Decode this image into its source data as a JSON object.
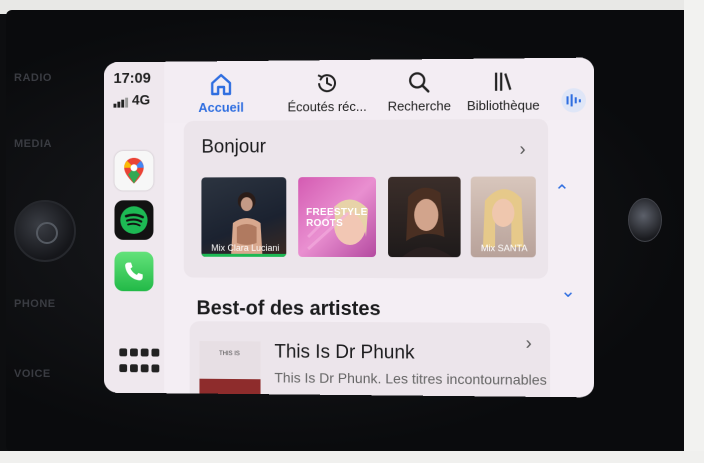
{
  "status": {
    "time": "17:09",
    "network": "4G"
  },
  "dock": {
    "apps": [
      {
        "name": "Google Maps"
      },
      {
        "name": "Spotify"
      },
      {
        "name": "Téléphone"
      }
    ]
  },
  "hardware": {
    "labels": [
      "RADIO",
      "MEDIA",
      "PHONE",
      "VOICE"
    ]
  },
  "tabs": [
    {
      "label": "Accueil",
      "icon": "home-icon",
      "active": true
    },
    {
      "label": "Écoutés réc...",
      "icon": "recent-icon",
      "active": false
    },
    {
      "label": "Recherche",
      "icon": "search-icon",
      "active": false
    },
    {
      "label": "Bibliothèque",
      "icon": "library-icon",
      "active": false
    }
  ],
  "home": {
    "greeting": "Bonjour",
    "tiles": [
      {
        "label": "Mix Clara Luciani"
      },
      {
        "label": "FREESTYLE ROOTS"
      },
      {
        "label": ""
      },
      {
        "label": "Mix SANTA"
      }
    ]
  },
  "section": {
    "title": "Best-of des artistes",
    "item_title": "This Is Dr Phunk",
    "item_subtitle": "This Is Dr Phunk. Les titres incontournables",
    "thumb_caption": "THIS IS"
  },
  "colors": {
    "accent": "#2f6ee0",
    "spotify": "#1db954",
    "screen_bg": "#f4eef4"
  }
}
